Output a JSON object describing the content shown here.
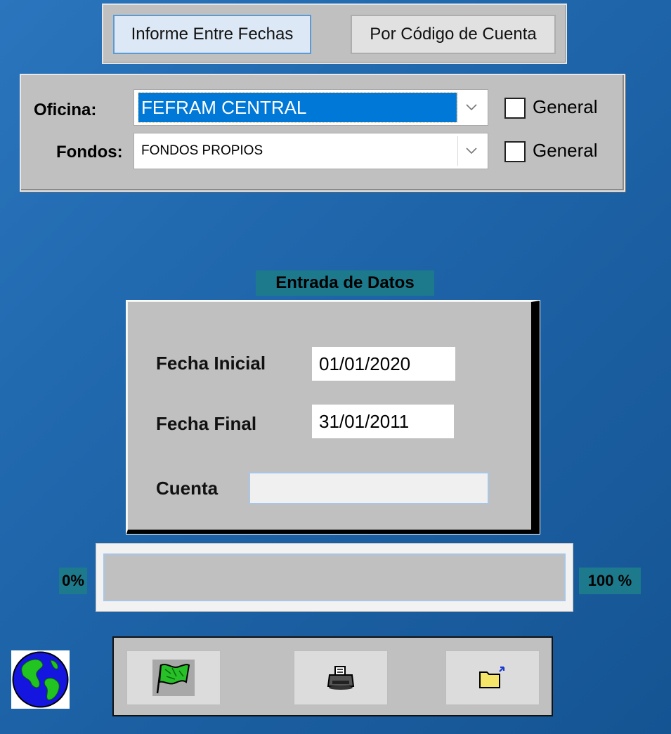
{
  "tabs": [
    {
      "label": "Informe Entre Fechas",
      "active": true
    },
    {
      "label": "Por Código de Cuenta",
      "active": false
    }
  ],
  "filters": {
    "oficina": {
      "label": "Oficina:",
      "value": "FEFRAM CENTRAL",
      "general_label": "General",
      "general_checked": false
    },
    "fondos": {
      "label": "Fondos:",
      "value": "FONDOS PROPIOS",
      "general_label": "General",
      "general_checked": false
    }
  },
  "entrada": {
    "title": "Entrada de Datos",
    "fecha_inicial_label": "Fecha Inicial",
    "fecha_inicial_value": "01/01/2020",
    "fecha_final_label": "Fecha Final",
    "fecha_final_value": "31/01/2011",
    "cuenta_label": "Cuenta",
    "cuenta_value": ""
  },
  "progress": {
    "min_label": "0%",
    "max_label": "100 %",
    "value": 0
  },
  "colors": {
    "background": "#1f66ab",
    "panel": "#c0c0c0",
    "label_bg": "#1c7a8c",
    "selection": "#0078d7"
  },
  "toolbar": {
    "icons": [
      "globe-icon",
      "green-flag-icon",
      "printer-icon",
      "folder-open-icon"
    ]
  }
}
